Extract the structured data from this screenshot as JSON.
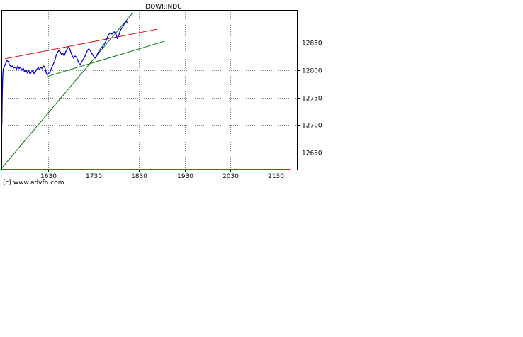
{
  "chart_data": {
    "type": "line",
    "title": "DOWI:INDU",
    "xlabel": "",
    "ylabel": "",
    "x_unit": "time (HHMM)",
    "xlim": [
      1527,
      2177
    ],
    "ylim": [
      12619,
      12910
    ],
    "x_ticks": [
      1630,
      1730,
      1830,
      1930,
      2030,
      2130
    ],
    "x_tick_labels": [
      "1630",
      "1730",
      "1830",
      "1930",
      "2030",
      "2130"
    ],
    "y_ticks": [
      12650,
      12700,
      12750,
      12800,
      12850
    ],
    "y_tick_labels": [
      "12650",
      "12700",
      "12750",
      "12800",
      "12850"
    ],
    "grid": true,
    "y_axis_side": "right",
    "series": [
      {
        "color": "#0000dd",
        "points": [
          [
            1528,
            12700
          ],
          [
            1529,
            12762
          ],
          [
            1530,
            12790
          ],
          [
            1531,
            12802
          ],
          [
            1533,
            12806
          ],
          [
            1536,
            12812
          ],
          [
            1539,
            12818
          ],
          [
            1542,
            12816
          ],
          [
            1545,
            12810
          ],
          [
            1548,
            12806
          ],
          [
            1551,
            12808
          ],
          [
            1554,
            12804
          ],
          [
            1557,
            12806
          ],
          [
            1560,
            12802
          ],
          [
            1563,
            12808
          ],
          [
            1566,
            12803
          ],
          [
            1569,
            12806
          ],
          [
            1572,
            12800
          ],
          [
            1575,
            12804
          ],
          [
            1578,
            12797
          ],
          [
            1581,
            12801
          ],
          [
            1584,
            12795
          ],
          [
            1587,
            12799
          ],
          [
            1590,
            12793
          ],
          [
            1593,
            12797
          ],
          [
            1596,
            12800
          ],
          [
            1599,
            12794
          ],
          [
            1602,
            12797
          ],
          [
            1605,
            12802
          ],
          [
            1608,
            12805
          ],
          [
            1611,
            12801
          ],
          [
            1614,
            12806
          ],
          [
            1617,
            12803
          ],
          [
            1620,
            12808
          ],
          [
            1623,
            12804
          ],
          [
            1626,
            12794
          ],
          [
            1629,
            12792
          ],
          [
            1632,
            12796
          ],
          [
            1635,
            12799
          ],
          [
            1638,
            12806
          ],
          [
            1641,
            12811
          ],
          [
            1644,
            12816
          ],
          [
            1647,
            12826
          ],
          [
            1650,
            12832
          ],
          [
            1653,
            12836
          ],
          [
            1656,
            12834
          ],
          [
            1659,
            12829
          ],
          [
            1662,
            12831
          ],
          [
            1665,
            12826
          ],
          [
            1668,
            12833
          ],
          [
            1671,
            12838
          ],
          [
            1674,
            12842
          ],
          [
            1677,
            12840
          ],
          [
            1680,
            12832
          ],
          [
            1683,
            12826
          ],
          [
            1686,
            12822
          ],
          [
            1689,
            12826
          ],
          [
            1692,
            12824
          ],
          [
            1695,
            12818
          ],
          [
            1698,
            12812
          ],
          [
            1701,
            12811
          ],
          [
            1704,
            12816
          ],
          [
            1707,
            12820
          ],
          [
            1710,
            12824
          ],
          [
            1713,
            12830
          ],
          [
            1716,
            12836
          ],
          [
            1719,
            12839
          ],
          [
            1722,
            12837
          ],
          [
            1725,
            12832
          ],
          [
            1728,
            12828
          ],
          [
            1731,
            12824
          ],
          [
            1734,
            12822
          ],
          [
            1737,
            12827
          ],
          [
            1740,
            12833
          ],
          [
            1743,
            12836
          ],
          [
            1746,
            12840
          ],
          [
            1749,
            12843
          ],
          [
            1752,
            12846
          ],
          [
            1755,
            12850
          ],
          [
            1758,
            12855
          ],
          [
            1761,
            12862
          ],
          [
            1764,
            12866
          ],
          [
            1767,
            12868
          ],
          [
            1770,
            12866
          ],
          [
            1773,
            12869
          ],
          [
            1776,
            12870
          ],
          [
            1779,
            12866
          ],
          [
            1782,
            12858
          ],
          [
            1785,
            12863
          ],
          [
            1788,
            12871
          ],
          [
            1791,
            12876
          ],
          [
            1794,
            12879
          ],
          [
            1797,
            12884
          ],
          [
            1800,
            12889
          ],
          [
            1803,
            12888
          ],
          [
            1806,
            12886
          ]
        ]
      }
    ],
    "trend_lines": [
      {
        "color": "#dd0000",
        "from": [
          1535,
          12821
        ],
        "to": [
          1870,
          12875
        ]
      },
      {
        "color": "#007700",
        "from": [
          1629,
          12789
        ],
        "to": [
          1886,
          12853
        ]
      },
      {
        "color": "#007700",
        "from": [
          1528,
          12622
        ],
        "to": [
          1815,
          12904
        ]
      },
      {
        "color": "#dd0000",
        "from": [
          1528,
          12619.5
        ],
        "to": [
          2162,
          12619.5
        ]
      }
    ]
  },
  "footer": {
    "copyright": "(c) www.advfn.com"
  }
}
